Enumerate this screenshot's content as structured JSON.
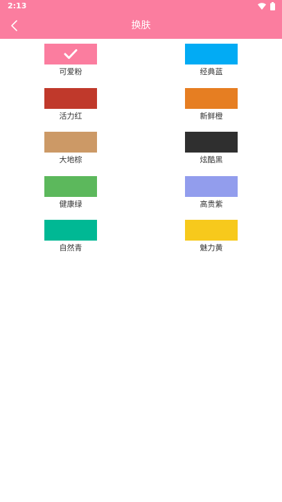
{
  "status_bar": {
    "time": "2:13",
    "icons": [
      "wifi-icon",
      "battery-icon"
    ]
  },
  "toolbar": {
    "title": "换肤",
    "back_icon": "chevron-left-icon"
  },
  "skins": [
    {
      "label": "可爱粉",
      "color": "#fb7d9f",
      "selected": true
    },
    {
      "label": "经典蓝",
      "color": "#02abf4",
      "selected": false
    },
    {
      "label": "活力红",
      "color": "#c0392b",
      "selected": false
    },
    {
      "label": "新鲜橙",
      "color": "#e67e22",
      "selected": false
    },
    {
      "label": "大地棕",
      "color": "#cc9966",
      "selected": false
    },
    {
      "label": "炫酷黑",
      "color": "#2f2f2f",
      "selected": false
    },
    {
      "label": "健康绿",
      "color": "#5cb85c",
      "selected": false
    },
    {
      "label": "高贵紫",
      "color": "#929ded",
      "selected": false
    },
    {
      "label": "自然青",
      "color": "#00b894",
      "selected": false
    },
    {
      "label": "魅力黄",
      "color": "#f7c91c",
      "selected": false
    }
  ]
}
